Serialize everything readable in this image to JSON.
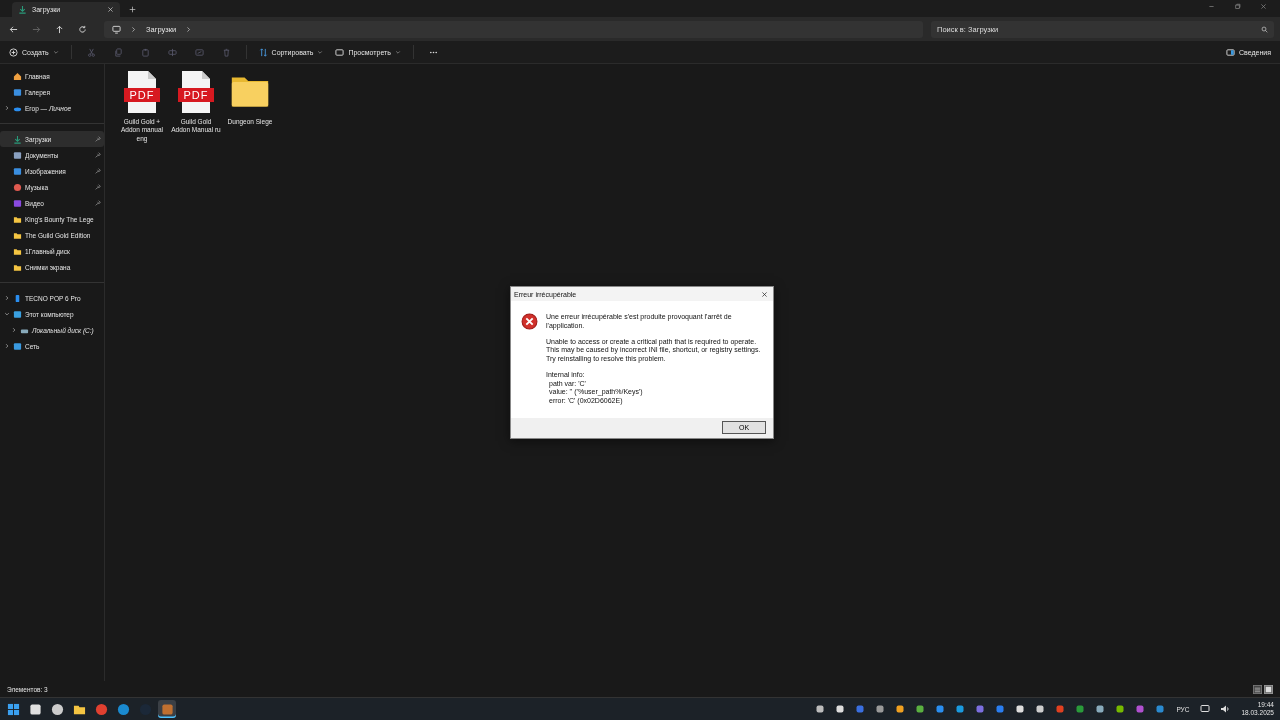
{
  "tabs": [
    {
      "label": "Загрузки",
      "selected": true
    }
  ],
  "address": {
    "crumbs": [
      "Загрузки"
    ]
  },
  "search": {
    "placeholder": "Поиск в: Загрузки"
  },
  "toolbar": {
    "create": "Создать",
    "sort": "Сортировать",
    "view": "Просмотреть",
    "details": "Сведения"
  },
  "sidebar": {
    "groups": [
      [
        {
          "label": "Главная",
          "kind": "home",
          "selected": false
        },
        {
          "label": "Галерея",
          "kind": "gallery",
          "selected": false
        },
        {
          "label": "Егор — *Личное*",
          "kind": "cloud",
          "selected": false,
          "expanded": false
        }
      ],
      [
        {
          "label": "Загрузки",
          "kind": "download",
          "selected": true,
          "pinned": true
        },
        {
          "label": "Документы",
          "kind": "documents",
          "selected": false,
          "pinned": true
        },
        {
          "label": "Изображения",
          "kind": "pictures",
          "selected": false,
          "pinned": true
        },
        {
          "label": "Музыка",
          "kind": "music",
          "selected": false,
          "pinned": true
        },
        {
          "label": "Видео",
          "kind": "video",
          "selected": false,
          "pinned": true
        },
        {
          "label": "King's Bounty The Lege",
          "kind": "folder",
          "selected": false
        },
        {
          "label": "The Guild Gold Edition",
          "kind": "folder",
          "selected": false
        },
        {
          "label": "1Главный диск",
          "kind": "folder",
          "selected": false
        },
        {
          "label": "Снимки экрана",
          "kind": "folder",
          "selected": false
        }
      ],
      [
        {
          "label": "TECNO POP 6 Pro",
          "kind": "phone",
          "selected": false,
          "expanded": false
        },
        {
          "label": "Этот компьютер",
          "kind": "computer",
          "selected": false,
          "expanded": true,
          "children": [
            {
              "label": "Локальный диск (C:)",
              "kind": "drive",
              "selected": false,
              "expanded": false
            }
          ]
        },
        {
          "label": "Сеть",
          "kind": "network",
          "selected": false,
          "expanded": false
        }
      ]
    ]
  },
  "files": [
    {
      "name": "Guild Gold + Addon manual eng",
      "kind": "pdf",
      "badge": "PDF"
    },
    {
      "name": "Guild Gold Addon Manual ru",
      "kind": "pdf",
      "badge": "PDF"
    },
    {
      "name": "Dungeon Siege",
      "kind": "folder"
    }
  ],
  "status_bar": {
    "count": "Элементов: 3"
  },
  "dialog": {
    "title": "Erreur irrécupérable",
    "paragraphs": [
      "Une erreur irrécupérable s'est produite provoquant l'arrêt de l'application.",
      "Unable to access or create a critical path that is required to operate. This may be caused by incorrect INI file, shortcut, or registry settings. Try reinstalling to resolve this problem."
    ],
    "info": [
      "Internal info:",
      "path var: 'C'",
      "value: '' ('%user_path%/Keys')",
      "error: 'C' (0x02D6062E)"
    ],
    "button": "OK"
  },
  "taskbar": {
    "apps": [
      {
        "kind": "start",
        "selected": false
      },
      {
        "kind": "store",
        "selected": false
      },
      {
        "kind": "clock",
        "selected": false
      },
      {
        "kind": "explorer",
        "selected": false
      },
      {
        "kind": "chrome",
        "selected": false
      },
      {
        "kind": "edge",
        "selected": false
      },
      {
        "kind": "steam",
        "selected": false
      },
      {
        "kind": "game",
        "selected": true
      }
    ],
    "language": "РУС",
    "time": "19:44",
    "date": "18.03.2025"
  }
}
